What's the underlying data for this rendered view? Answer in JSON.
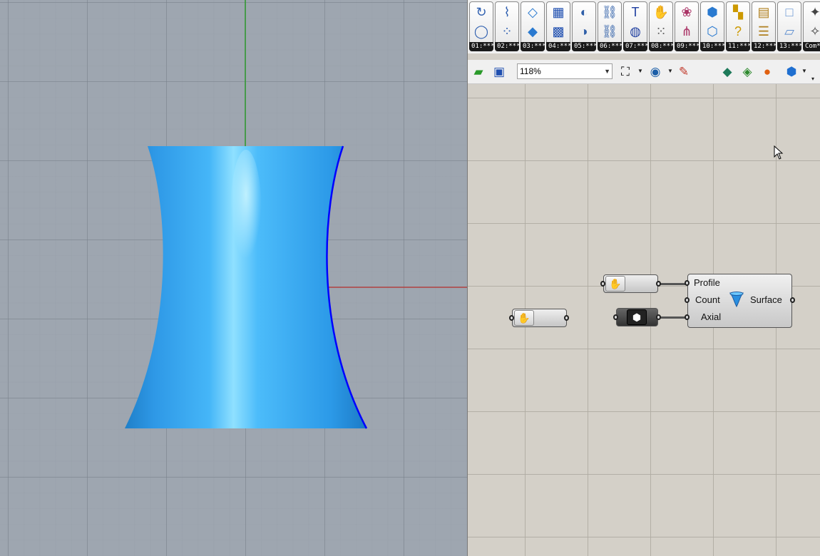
{
  "viewport": {
    "name": "Rhino 3D viewport",
    "shape_color": "#3aa8ee",
    "x_axis_color": "#b04040",
    "y_axis_color": "#2e9a2e",
    "profile_curve_color": "#0000ff"
  },
  "tabs": [
    {
      "label": "01:***",
      "icon_top": "curve-icon",
      "icon_bottom": "circle-icon"
    },
    {
      "label": "02:***",
      "icon_top": "nurbs-icon",
      "icon_bottom": "nurbs-points-icon"
    },
    {
      "label": "03:***",
      "icon_top": "surface-re-icon",
      "icon_bottom": "surface-sq-icon"
    },
    {
      "label": "04:***",
      "icon_top": "mesh-icon",
      "icon_bottom": "mesh-grid-icon"
    },
    {
      "label": "05:***",
      "icon_top": "boolean-icon",
      "icon_bottom": "intersect-icon"
    },
    {
      "label": "06:***",
      "icon_top": "chain-icon",
      "icon_bottom": "chain-2-icon"
    },
    {
      "label": "07:***",
      "icon_top": "text-icon",
      "icon_bottom": "globe-icon"
    },
    {
      "label": "08:***",
      "icon_top": "hand-icon",
      "icon_bottom": "points-icon"
    },
    {
      "label": "09:***",
      "icon_top": "brain-icon",
      "icon_bottom": "nodes-icon"
    },
    {
      "label": "10:***",
      "icon_top": "cube-icon",
      "icon_bottom": "cube-2-icon"
    },
    {
      "label": "11:***",
      "icon_top": "color-grid-icon",
      "icon_bottom": "question-icon"
    },
    {
      "label": "12:***",
      "icon_top": "box-icon",
      "icon_bottom": "stack-icon"
    },
    {
      "label": "13:***",
      "icon_top": "square-icon",
      "icon_bottom": "shape-icon"
    },
    {
      "label": "Com***",
      "icon_top": "figure-icon",
      "icon_bottom": "figure-2-icon"
    }
  ],
  "toolbar": {
    "zoom": "118%"
  },
  "canvas": {
    "revolve": {
      "inputs": [
        "Profile",
        "Count",
        "Axial"
      ],
      "output": "Surface"
    }
  }
}
